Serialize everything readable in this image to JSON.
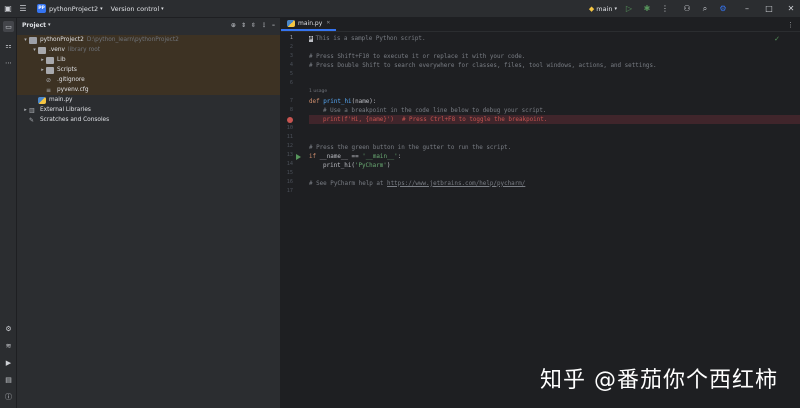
{
  "titlebar": {
    "project_badge": "PP",
    "project_name": "pythonProject2",
    "vcs_label": "Version control",
    "run_config": "main",
    "icons": [
      "app-menu-icon",
      "python-icon",
      "run-icon",
      "debug-icon",
      "more-icon",
      "add-user-icon",
      "search-icon",
      "settings-icon",
      "minimize-icon",
      "maximize-icon",
      "close-icon"
    ]
  },
  "project_panel": {
    "title": "Project",
    "tree": [
      {
        "label": "pythonProject2",
        "hint": "D:\\python_learn\\pythonProject2",
        "kind": "folder"
      },
      {
        "label": ".venv",
        "hint": "library root",
        "kind": "folder"
      },
      {
        "label": "Lib",
        "hint": "",
        "kind": "folder"
      },
      {
        "label": "Scripts",
        "hint": "",
        "kind": "folder"
      },
      {
        "label": ".gitignore",
        "hint": "",
        "kind": "file"
      },
      {
        "label": "pyvenv.cfg",
        "hint": "",
        "kind": "file"
      },
      {
        "label": "main.py",
        "hint": "",
        "kind": "python"
      },
      {
        "label": "External Libraries",
        "hint": "",
        "kind": "lib"
      },
      {
        "label": "Scratches and Consoles",
        "hint": "",
        "kind": "scratch"
      }
    ]
  },
  "editor": {
    "tab_label": "main.py",
    "line_numbers": [
      "1",
      "2",
      "3",
      "4",
      "5",
      "6",
      "7",
      "8",
      "9",
      "10",
      "11",
      "12",
      "13",
      "14",
      "15",
      "16",
      "17"
    ],
    "usage_hint": "1 usage",
    "lines": {
      "l1": "This is a sample Python script.",
      "l3": "# Press Shift+F10 to execute it or replace it with your code.",
      "l4": "# Press Double Shift to search everywhere for classes, files, tool windows, actions, and settings.",
      "l7_kw": "def",
      "l7_fn": "print_hi",
      "l7_rest": "(name):",
      "l8": "# Use a breakpoint in the code line below to debug your script.",
      "l9_code": "print(f'Hi, {name}')",
      "l9_comment": "# Press Ctrl+F8 to toggle the breakpoint.",
      "l12": "# Press the green button in the gutter to run the script.",
      "l13_kw": "if",
      "l13_mid": "__name__ == ",
      "l13_str": "'__main__'",
      "l13_end": ":",
      "l14_a": "print_hi(",
      "l14_str": "'PyCharm'",
      "l14_b": ")",
      "l16_a": "# See PyCharm help at ",
      "l16_link": "https://www.jetbrains.com/help/pycharm/"
    }
  },
  "watermark": "知乎 @番茄你个西红柿"
}
